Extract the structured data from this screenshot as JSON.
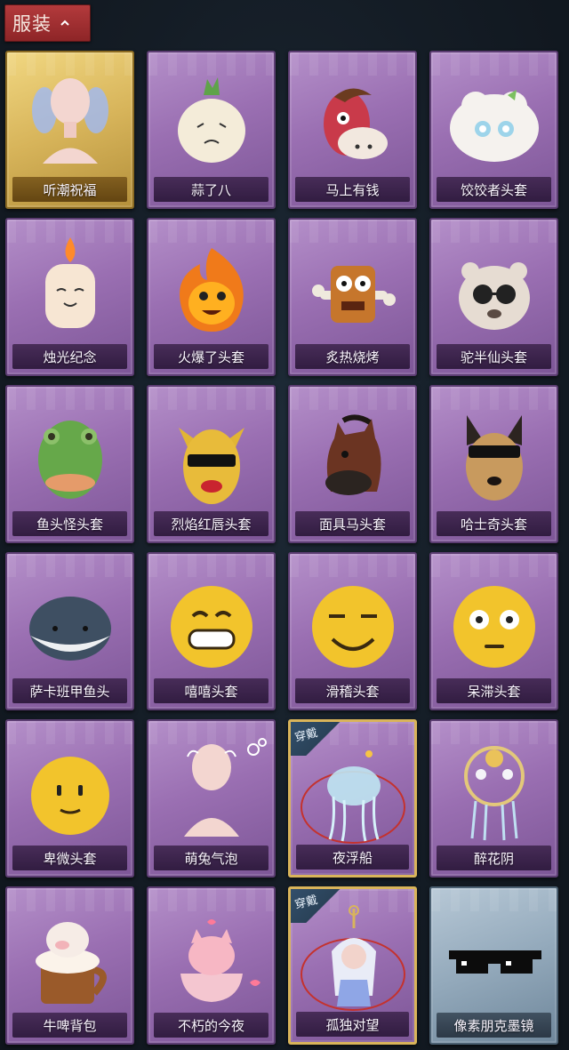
{
  "header": {
    "title": "服装",
    "icon": "chevron-up-icon"
  },
  "badge_label": "穿戴",
  "items": [
    {
      "label": "听潮祝福",
      "style": "gold"
    },
    {
      "label": "蒜了八",
      "style": "purple"
    },
    {
      "label": "马上有钱",
      "style": "purple"
    },
    {
      "label": "饺饺者头套",
      "style": "purple"
    },
    {
      "label": "烛光纪念",
      "style": "purple"
    },
    {
      "label": "火爆了头套",
      "style": "purple"
    },
    {
      "label": "炙热烧烤",
      "style": "purple"
    },
    {
      "label": "驼半仙头套",
      "style": "purple"
    },
    {
      "label": "鱼头怪头套",
      "style": "purple"
    },
    {
      "label": "烈焰红唇头套",
      "style": "purple"
    },
    {
      "label": "面具马头套",
      "style": "purple"
    },
    {
      "label": "哈士奇头套",
      "style": "purple"
    },
    {
      "label": "萨卡班甲鱼头",
      "style": "purple"
    },
    {
      "label": "嘻嘻头套",
      "style": "purple"
    },
    {
      "label": "滑稽头套",
      "style": "purple"
    },
    {
      "label": "呆滞头套",
      "style": "purple"
    },
    {
      "label": "卑微头套",
      "style": "purple"
    },
    {
      "label": "萌兔气泡",
      "style": "purple"
    },
    {
      "label": "夜浮船",
      "style": "purple",
      "equipped": true
    },
    {
      "label": "醉花阴",
      "style": "purple"
    },
    {
      "label": "牛啤背包",
      "style": "purple"
    },
    {
      "label": "不朽的今夜",
      "style": "purple"
    },
    {
      "label": "孤独对望",
      "style": "purple",
      "equipped": true
    },
    {
      "label": "像素朋克墨镜",
      "style": "blue"
    }
  ]
}
